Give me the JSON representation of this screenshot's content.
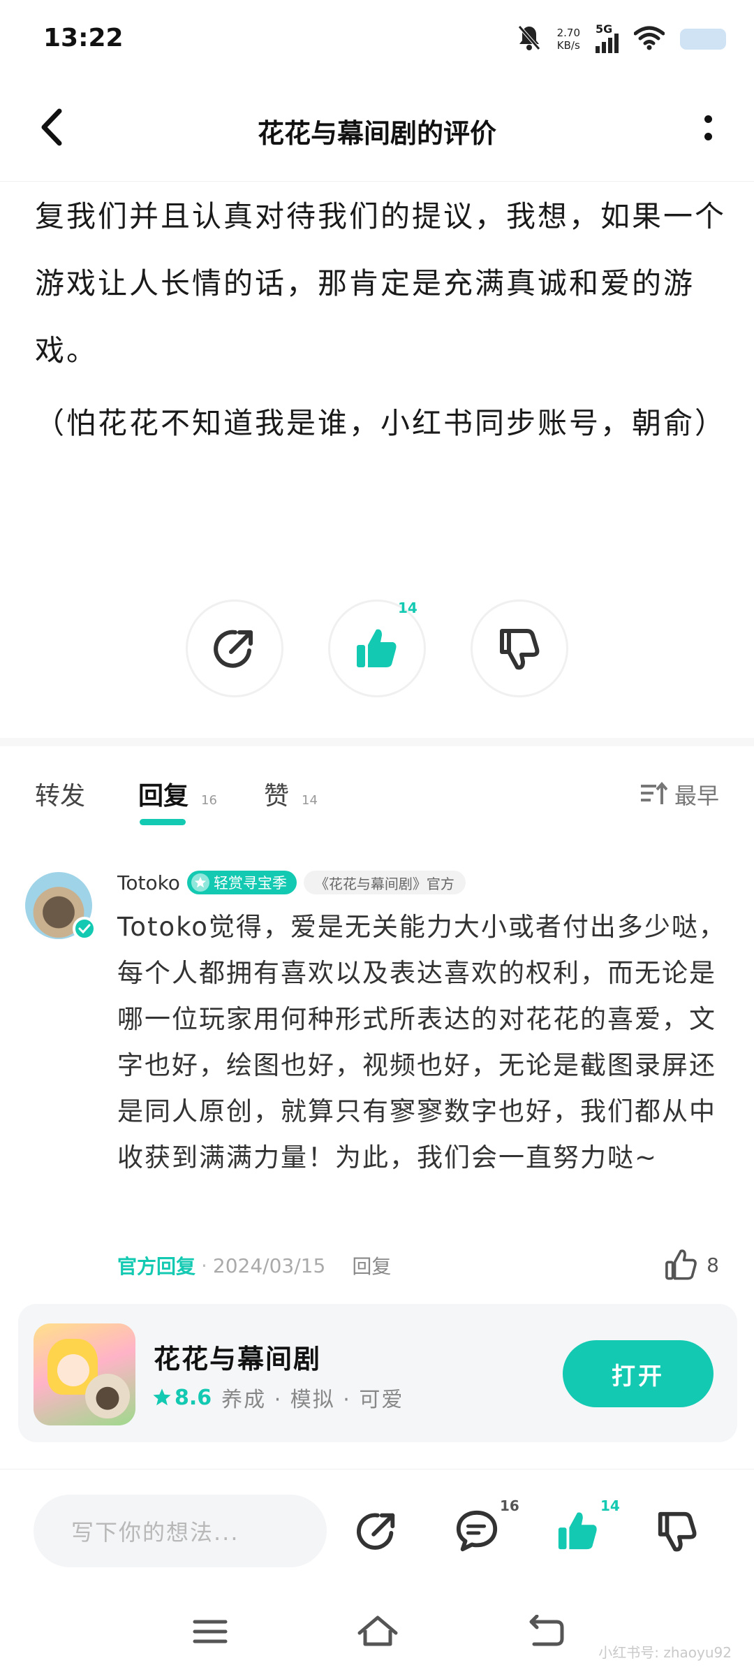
{
  "status_bar": {
    "time": "13:22",
    "net_speed_value": "2.70",
    "net_speed_unit": "KB/s",
    "network": "5G"
  },
  "header": {
    "title": "花花与幕间剧的评价"
  },
  "review": {
    "paragraphs": [
      "复我们并且认真对待我们的提议，我想，如果一个游戏让人长情的话，那肯定是充满真诚和爱的游戏。",
      "（怕花花不知道我是谁，小红书同步账号，朝俞）"
    ]
  },
  "actions": {
    "like_count": "14"
  },
  "tabs": {
    "forward_label": "转发",
    "reply_label": "回复",
    "reply_count": "16",
    "likes_label": "赞",
    "likes_count": "14",
    "sort_label": "最早"
  },
  "comment": {
    "author": "Totoko",
    "user_badge": "轻赏寻宝季",
    "official_badge": "《花花与幕间剧》官方",
    "text": "Totoko觉得，爱是无关能力大小或者付出多少哒，每个人都拥有喜欢以及表达喜欢的权利，而无论是哪一位玩家用何种形式所表达的对花花的喜爱，文字也好，绘图也好，视频也好，无论是截图录屏还是同人原创，就算只有寥寥数字也好，我们都从中收获到满满力量！为此，我们会一直努力哒~",
    "official_reply_label": "官方回复",
    "date": "2024/03/15",
    "reply_label": "回复",
    "like_count": "8"
  },
  "app_card": {
    "name": "花花与幕间剧",
    "rating": "8.6",
    "tags": "养成 · 模拟 · 可爱",
    "open_label": "打开"
  },
  "bottom_bar": {
    "input_placeholder": "写下你的想法...",
    "comment_count": "16",
    "like_count": "14"
  },
  "watermark": "小红书号: zhaoyu92",
  "colors": {
    "accent": "#13c9b2",
    "text": "#1a1a1a",
    "muted": "#888888"
  },
  "icons": [
    "back-arrow-icon",
    "more-icon",
    "share-icon",
    "thumbs-up-icon",
    "thumbs-down-icon",
    "sort-icon",
    "comment-icon",
    "star-icon",
    "menu-icon",
    "home-icon",
    "back-nav-icon",
    "bell-off-icon",
    "signal-icon",
    "wifi-icon",
    "battery-icon",
    "verified-icon"
  ]
}
